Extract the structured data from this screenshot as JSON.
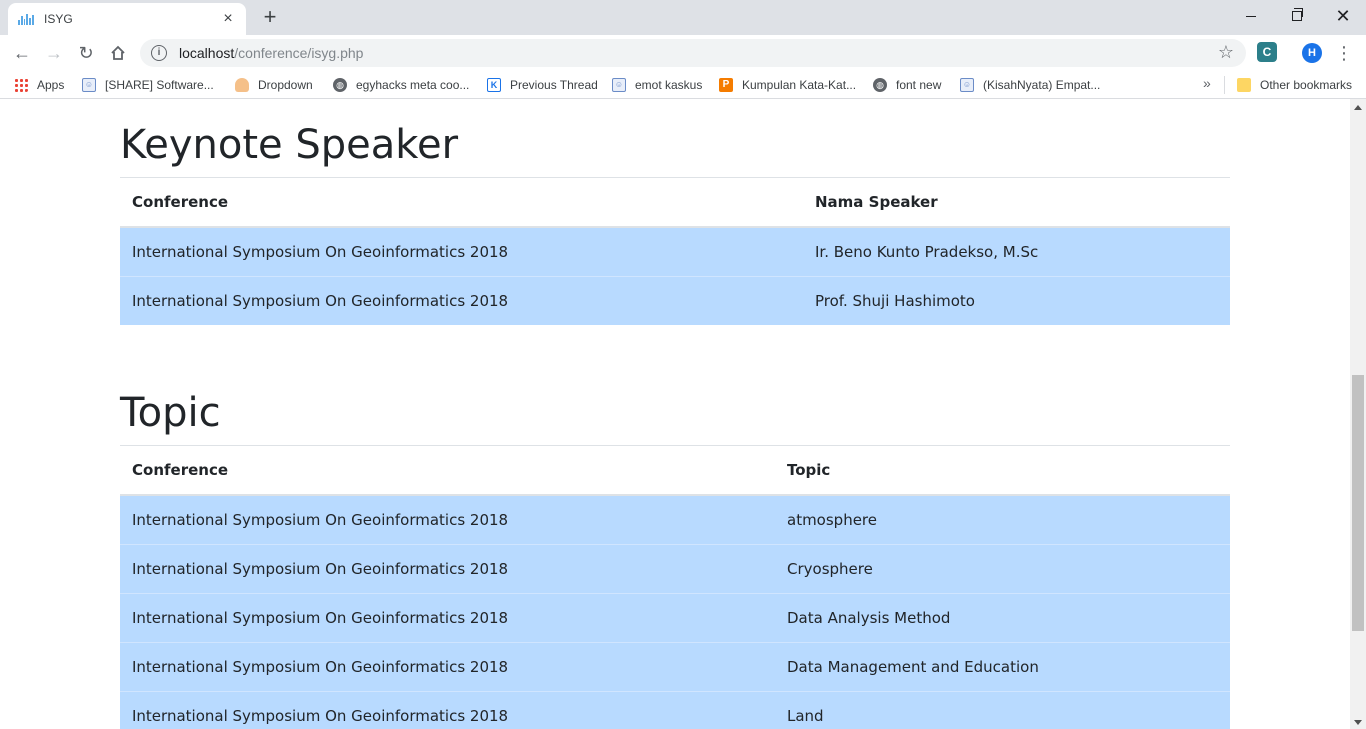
{
  "browser": {
    "tab_title": "ISYG",
    "tab_close": "×",
    "new_tab": "+",
    "url_host": "localhost",
    "url_path": "/conference/isyg.php",
    "avatar_letter": "H",
    "icons": [
      "back-icon",
      "forward-icon",
      "reload-icon",
      "home-icon",
      "info-icon",
      "star-icon",
      "extension-icon",
      "menu-icon"
    ]
  },
  "bookmarks": {
    "items": [
      {
        "label": "Apps",
        "icon": "apps-icon"
      },
      {
        "label": "[SHARE] Software...",
        "icon": "kaskus-icon"
      },
      {
        "label": "Dropdown",
        "icon": "person-icon"
      },
      {
        "label": "egyhacks meta coo...",
        "icon": "globe-icon"
      },
      {
        "label": "Previous Thread",
        "icon": "kaskus-k-icon"
      },
      {
        "label": "emot kaskus",
        "icon": "kaskus-icon"
      },
      {
        "label": "Kumpulan Kata-Kat...",
        "icon": "p-icon"
      },
      {
        "label": "font new",
        "icon": "globe-icon"
      },
      {
        "label": "(KisahNyata) Empat...",
        "icon": "kaskus-icon"
      }
    ],
    "more": "»",
    "other": "Other bookmarks"
  },
  "keynote": {
    "title": "Keynote Speaker",
    "headers": [
      "Conference",
      "Nama Speaker"
    ],
    "rows": [
      [
        "International Symposium On Geoinformatics 2018",
        "Ir. Beno Kunto Pradekso, M.Sc"
      ],
      [
        "International Symposium On Geoinformatics 2018",
        "Prof. Shuji Hashimoto"
      ]
    ]
  },
  "topic": {
    "title": "Topic",
    "headers": [
      "Conference",
      "Topic"
    ],
    "rows": [
      [
        "International Symposium On Geoinformatics 2018",
        "atmosphere"
      ],
      [
        "International Symposium On Geoinformatics 2018",
        "Cryosphere"
      ],
      [
        "International Symposium On Geoinformatics 2018",
        "Data Analysis Method"
      ],
      [
        "International Symposium On Geoinformatics 2018",
        "Data Management and Education"
      ],
      [
        "International Symposium On Geoinformatics 2018",
        "Land"
      ]
    ]
  },
  "colors": {
    "row_bg": "#b8daff",
    "text": "#212529",
    "rule": "#dee2e6"
  }
}
